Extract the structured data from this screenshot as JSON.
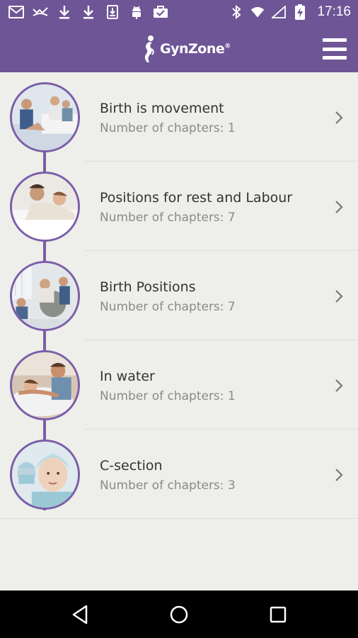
{
  "status_bar": {
    "time": "17:16",
    "left_icons": [
      "gmail-icon",
      "missed-call-icon",
      "download-icon",
      "download-icon",
      "download-box-icon",
      "android-debug-icon",
      "briefcase-check-icon"
    ],
    "right_icons": [
      "bluetooth-icon",
      "wifi-icon",
      "signal-icon",
      "battery-charging-icon"
    ]
  },
  "app_bar": {
    "logo_text": "GynZone",
    "logo_mark": "®",
    "menu_icon": "hamburger-menu-icon"
  },
  "colors": {
    "primary": "#6e5596",
    "accent": "#7a5ea8",
    "background": "#eeeeea"
  },
  "items": [
    {
      "title": "Birth is movement",
      "subtitle": "Number of chapters: 1"
    },
    {
      "title": "Positions for rest and Labour",
      "subtitle": "Number of chapters: 7"
    },
    {
      "title": "Birth Positions",
      "subtitle": "Number of chapters: 7"
    },
    {
      "title": "In water",
      "subtitle": "Number of chapters: 1"
    },
    {
      "title": "C-section",
      "subtitle": "Number of chapters: 3"
    }
  ],
  "nav_bar": {
    "back": "back-triangle-icon",
    "home": "home-circle-icon",
    "recents": "recents-square-icon"
  }
}
